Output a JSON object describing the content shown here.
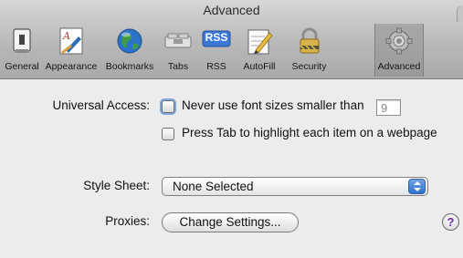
{
  "window": {
    "title": "Advanced"
  },
  "toolbar": {
    "items": [
      {
        "label": "General",
        "icon": "general-switch-icon"
      },
      {
        "label": "Appearance",
        "icon": "appearance-font-icon"
      },
      {
        "label": "Bookmarks",
        "icon": "bookmarks-globe-icon"
      },
      {
        "label": "Tabs",
        "icon": "tabs-icon"
      },
      {
        "label": "RSS",
        "icon": "rss-icon",
        "badge": "RSS"
      },
      {
        "label": "AutoFill",
        "icon": "autofill-pencil-icon"
      },
      {
        "label": "Security",
        "icon": "security-lock-icon"
      },
      {
        "label": "Advanced",
        "icon": "advanced-gear-icon",
        "selected": true
      }
    ]
  },
  "universal_access": {
    "label": "Universal Access:",
    "min_font_option": {
      "text": "Never use font sizes smaller than",
      "checked": false,
      "value": "9"
    },
    "tab_option": {
      "text": "Press Tab to highlight each item on a webpage",
      "checked": false
    }
  },
  "style_sheet": {
    "label": "Style Sheet:",
    "selected": "None Selected"
  },
  "proxies": {
    "label": "Proxies:",
    "button": "Change Settings..."
  },
  "help": {
    "glyph": "?"
  },
  "colors": {
    "accent": "#2e6ed0",
    "focus_ring": "#7fa8e0",
    "selected_tab": "#9a9a9a"
  }
}
